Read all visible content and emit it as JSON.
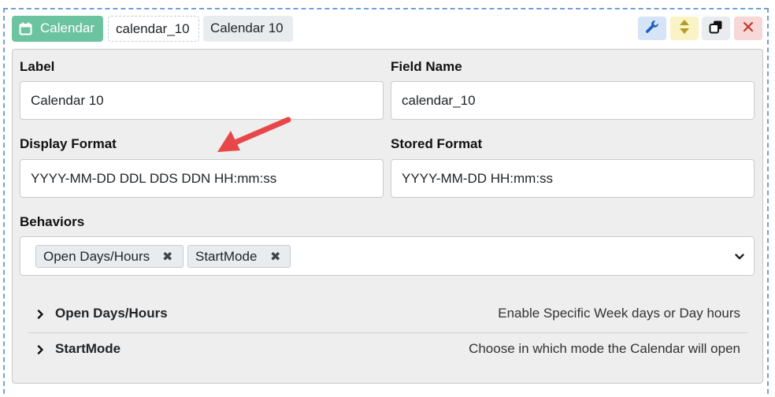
{
  "header": {
    "type_tag": "Calendar",
    "field_name_tag": "calendar_10",
    "label_tag": "Calendar 10"
  },
  "toolbar": {
    "settings_icon": "wrench-icon",
    "move_icon": "sort-arrows-icon",
    "duplicate_icon": "copy-icon",
    "delete_icon": "close-icon"
  },
  "form": {
    "label_title": "Label",
    "label_value": "Calendar 10",
    "field_name_title": "Field Name",
    "field_name_value": "calendar_10",
    "display_format_title": "Display Format",
    "display_format_value": "YYYY-MM-DD DDL DDS DDN HH:mm:ss",
    "stored_format_title": "Stored Format",
    "stored_format_value": "YYYY-MM-DD HH:mm:ss"
  },
  "behaviors": {
    "title": "Behaviors",
    "selected": [
      "Open Days/Hours",
      "StartMode"
    ]
  },
  "accordion": [
    {
      "title": "Open Days/Hours",
      "description": "Enable Specific Week days or Day hours"
    },
    {
      "title": "StartMode",
      "description": "Choose in which mode the Calendar will open"
    }
  ],
  "colors": {
    "accent_green": "#6cc3a0",
    "annotation_arrow": "#e8474a",
    "dashed_border": "#6fa0dc"
  }
}
